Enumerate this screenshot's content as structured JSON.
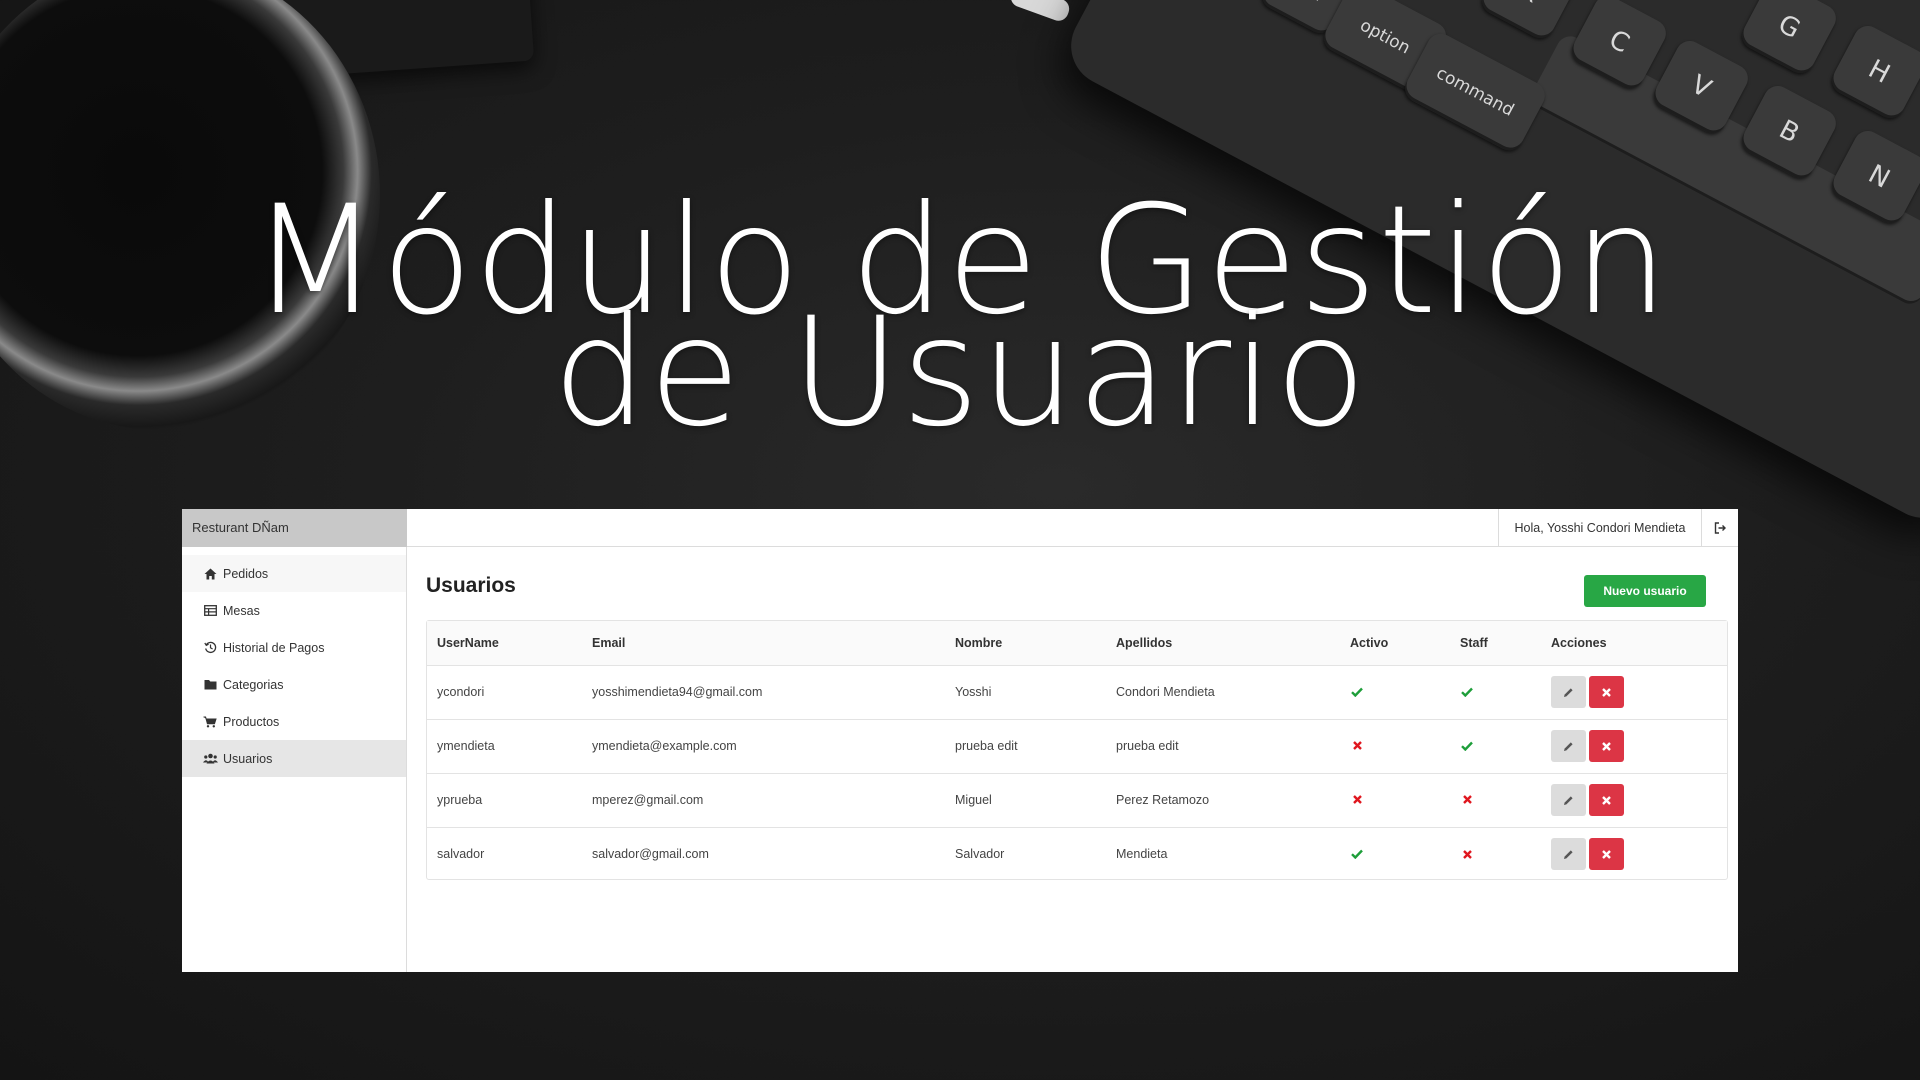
{
  "hero": {
    "line1": "Módulo de Gestión",
    "line2": "de Usuario"
  },
  "keyboard": {
    "keys": [
      "rol",
      "option",
      "command",
      "X",
      "C",
      "V",
      "G",
      "B",
      "H",
      "N"
    ]
  },
  "app": {
    "brand": "Resturant DÑam",
    "greeting": "Hola, Yosshi Condori Mendieta",
    "sidebar": {
      "items": [
        {
          "label": "Pedidos",
          "icon": "home-icon"
        },
        {
          "label": "Mesas",
          "icon": "table-icon"
        },
        {
          "label": "Historial de Pagos",
          "icon": "history-icon"
        },
        {
          "label": "Categorias",
          "icon": "folder-icon"
        },
        {
          "label": "Productos",
          "icon": "cart-icon"
        },
        {
          "label": "Usuarios",
          "icon": "users-icon",
          "active": true
        }
      ]
    },
    "page_title": "Usuarios",
    "new_user_label": "Nuevo usuario",
    "table": {
      "headers": [
        "UserName",
        "Email",
        "Nombre",
        "Apellidos",
        "Activo",
        "Staff",
        "Acciones"
      ],
      "rows": [
        {
          "username": "ycondori",
          "email": "yosshimendieta94@gmail.com",
          "nombre": "Yosshi",
          "apellidos": "Condori Mendieta",
          "activo": true,
          "staff": true
        },
        {
          "username": "ymendieta",
          "email": "ymendieta@example.com",
          "nombre": "prueba edit",
          "apellidos": "prueba edit",
          "activo": false,
          "staff": true
        },
        {
          "username": "yprueba",
          "email": "mperez@gmail.com",
          "nombre": "Miguel",
          "apellidos": "Perez Retamozo",
          "activo": false,
          "staff": false
        },
        {
          "username": "salvador",
          "email": "salvador@gmail.com",
          "nombre": "Salvador",
          "apellidos": "Mendieta",
          "activo": true,
          "staff": false
        }
      ]
    },
    "colors": {
      "success": "#28a745",
      "danger": "#dc3545",
      "check": "#1e9e3a",
      "cross": "#e0161e"
    }
  }
}
